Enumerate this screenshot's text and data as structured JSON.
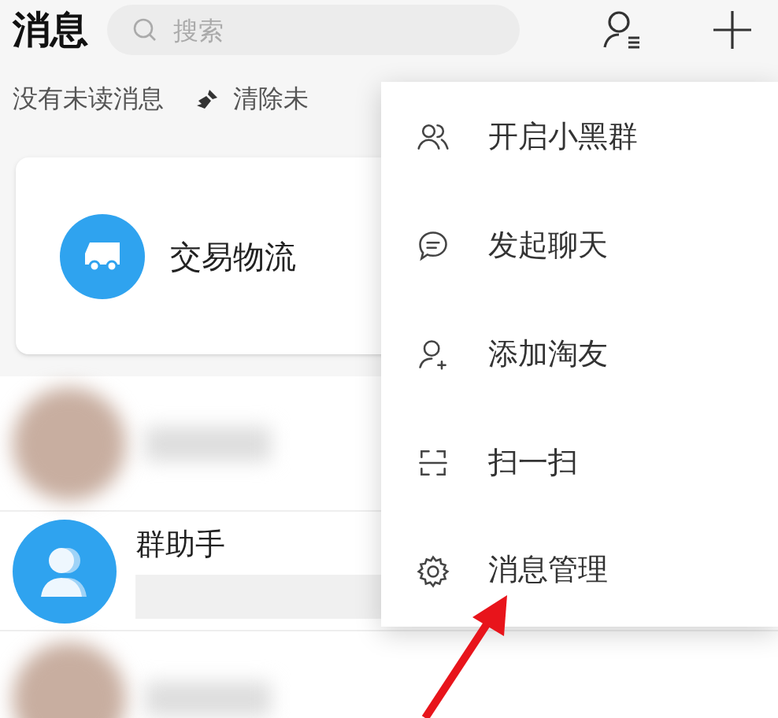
{
  "header": {
    "title": "消息",
    "search": {
      "placeholder": "搜索"
    }
  },
  "status": {
    "text": "没有未读消息",
    "clear_label": "清除未"
  },
  "logistics": {
    "label": "交易物流"
  },
  "conversations": [
    {
      "kind": "blurred"
    },
    {
      "kind": "group",
      "name": "群助手"
    },
    {
      "kind": "blurred"
    }
  ],
  "menu": [
    {
      "kind": "group",
      "label": "开启小黑群"
    },
    {
      "kind": "chat",
      "label": "发起聊天"
    },
    {
      "kind": "add",
      "label": "添加淘友"
    },
    {
      "kind": "scan",
      "label": "扫一扫"
    },
    {
      "kind": "settings",
      "label": "消息管理"
    }
  ]
}
